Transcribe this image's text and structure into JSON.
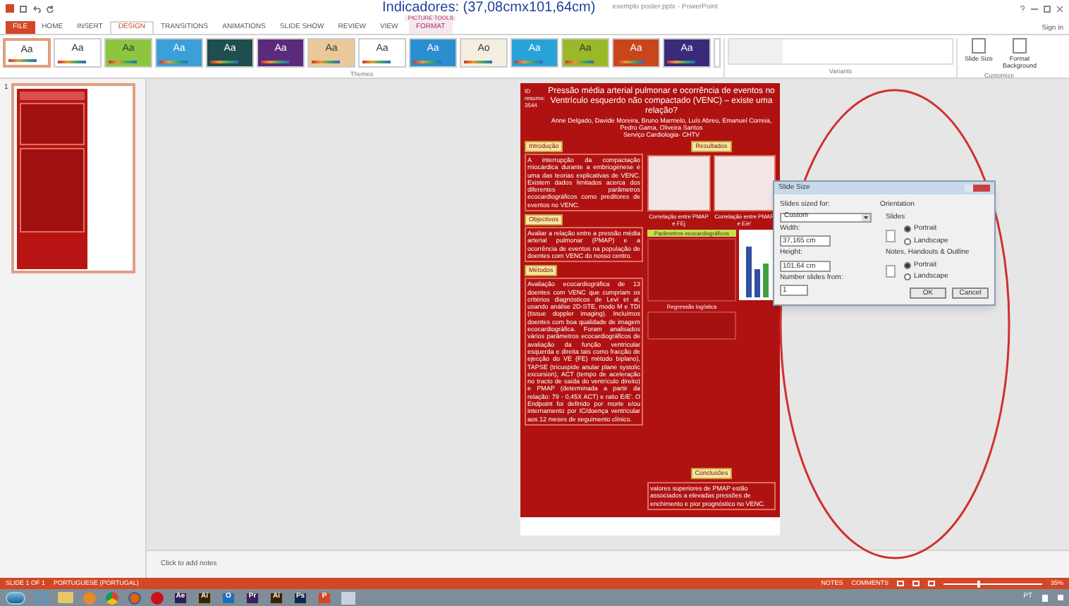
{
  "caption": "Indicadores: (37,08cmx101,64cm)",
  "window": {
    "title": "exemplo poster.pptx - PowerPoint",
    "sign_in": "Sign in"
  },
  "context_tab_group": "PICTURE TOOLS",
  "tabs": [
    {
      "label": "FILE",
      "kind": "file",
      "selected": false
    },
    {
      "label": "HOME",
      "kind": "tab",
      "selected": false
    },
    {
      "label": "INSERT",
      "kind": "tab",
      "selected": false
    },
    {
      "label": "DESIGN",
      "kind": "tab",
      "selected": true
    },
    {
      "label": "TRANSITIONS",
      "kind": "tab",
      "selected": false
    },
    {
      "label": "ANIMATIONS",
      "kind": "tab",
      "selected": false
    },
    {
      "label": "SLIDE SHOW",
      "kind": "tab",
      "selected": false
    },
    {
      "label": "REVIEW",
      "kind": "tab",
      "selected": false
    },
    {
      "label": "VIEW",
      "kind": "tab",
      "selected": false
    },
    {
      "label": "FORMAT",
      "kind": "context",
      "selected": false
    }
  ],
  "themes": {
    "label": "Themes",
    "items": [
      {
        "label": "Aa",
        "color": "#ffffff",
        "selected": true
      },
      {
        "label": "Aa",
        "color": "#ffffff",
        "selected": false
      },
      {
        "label": "Aa",
        "color": "#8cc63f",
        "selected": false
      },
      {
        "label": "Aa",
        "color": "#3b9fd8",
        "selected": false
      },
      {
        "label": "Aa",
        "color": "#1f4e4e",
        "selected": false
      },
      {
        "label": "Aa",
        "color": "#5b2a7a",
        "selected": false
      },
      {
        "label": "Aa",
        "color": "#e9c99a",
        "selected": false
      },
      {
        "label": "Aa",
        "color": "#ffffff",
        "selected": false
      },
      {
        "label": "Aa",
        "color": "#2a8fd0",
        "selected": false
      },
      {
        "label": "Ao",
        "color": "#f3efe0",
        "selected": false
      },
      {
        "label": "Aa",
        "color": "#27a3d8",
        "selected": false
      },
      {
        "label": "Aa",
        "color": "#9bb828",
        "selected": false
      },
      {
        "label": "Aa",
        "color": "#c9461a",
        "selected": false
      },
      {
        "label": "Aa",
        "color": "#3a2a7a",
        "selected": false
      }
    ]
  },
  "variants": {
    "label": "Variants"
  },
  "customize": {
    "label": "Customize",
    "buttons": [
      "Slide Size",
      "Format Background"
    ]
  },
  "thumbnail": {
    "number": "1",
    "selected": true
  },
  "poster": {
    "id": "ID resumo: 3544",
    "title": "Pressão média arterial pulmonar e ocorrência de eventos no Ventrículo esquerdo não compactado (VENC) – existe uma relação?",
    "authors": "Anne Delgado, Davide Moreira, Bruno Marmelo, Luís Abreu, Emanuel Correia, Pedro Gama, Oliveira Santos",
    "service": "Serviço Cardiologia- CHTV",
    "sections": [
      {
        "heading": "Introdução",
        "text": "A interrupção da compactação miocárdica durante a embriogénese é uma das teorias explicativas de VENC. Existem dados limitados acerca dos diferentes parâmetros ecocardiográficos como preditores de eventos no VENC."
      },
      {
        "heading": "Objectivos",
        "text": "Avaliar a relação entre a pressão média arterial pulmonar (PMAP) e a ocorrência de eventos na população de doentes com VENC do nosso centro."
      },
      {
        "heading": "Métodos",
        "text": "Avaliação ecocardiográfica de 13 doentes com VENC que cumpriam os critérios diagnósticos de Levi et al, usando análise 2D-STE, modo M e TDI (tissue doppler imaging). Incluímos doentes com boa qualidade de imagem ecocardiográfica. Foram analisados vários parâmetros ecocardiográficos de avaliação da função ventricular esquerda e direita tais como fracção de ejecção do VE (FE) método biplano), TAPSE (tricuspide anular plane systolic excursion), ACT (tempo de aceleração no tracto de saída do ventrículo direito) e PMAP (determinada a partir da relação: 79 - 0,45X ACT) e ratio E/E'. O Endpoint foi definido por morte e/ou internamento por IC/doença ventricular aos 12 meses de seguimento clínico."
      }
    ],
    "results": {
      "heading": "Resultados",
      "captions": [
        "Correlação entre PMAP e FEj",
        "Correlação entre PMAP e E/e'"
      ],
      "table_title": "Parâmetros ecocardiográficos",
      "regression": "Regressão logística"
    },
    "conclusion": {
      "heading": "Conclusões",
      "text": "valores superiores de PMAP estão associados a elevadas pressões de enchimento e pior prognóstico no VENC."
    }
  },
  "notes": {
    "placeholder": "Click to add notes"
  },
  "dialog": {
    "title": "Slide Size",
    "sized_for_label": "Slides sized for:",
    "sized_for": "Custom",
    "width_label": "Width:",
    "width": "37,165 cm",
    "height_label": "Height:",
    "height": "101,64 cm",
    "number_label": "Number slides from:",
    "number": "1",
    "orientation": "Orientation",
    "groups": [
      {
        "label": "Slides",
        "options": [
          {
            "label": "Portrait",
            "selected": true
          },
          {
            "label": "Landscape",
            "selected": false
          }
        ]
      },
      {
        "label": "Notes, Handouts & Outline",
        "options": [
          {
            "label": "Portrait",
            "selected": true
          },
          {
            "label": "Landscape",
            "selected": false
          }
        ]
      }
    ],
    "buttons": [
      "OK",
      "Cancel"
    ]
  },
  "status_bar": {
    "slide": "SLIDE 1 OF 1",
    "language": "PORTUGUESE (PORTUGAL)",
    "notes": "NOTES",
    "comments": "COMMENTS",
    "zoom": "35%",
    "level": 0.35
  },
  "taskbar": {
    "apps": [
      {
        "kind": "start"
      },
      {
        "kind": "browser"
      },
      {
        "kind": "folder"
      },
      {
        "kind": "media"
      },
      {
        "kind": "chrome"
      },
      {
        "kind": "firefox"
      },
      {
        "kind": "opera"
      },
      {
        "kind": "letter",
        "label": "Ae",
        "color": "#2a1f5c"
      },
      {
        "kind": "letter",
        "label": "Ai",
        "color": "#3a2400"
      },
      {
        "kind": "letter",
        "label": "O",
        "color": "#1e6fc2"
      },
      {
        "kind": "letter",
        "label": "Pr",
        "color": "#3a1f5c"
      },
      {
        "kind": "letter",
        "label": "Ai",
        "color": "#3a2400"
      },
      {
        "kind": "letter",
        "label": "Ps",
        "color": "#0f2a4a"
      },
      {
        "kind": "letter",
        "label": "P",
        "color": "#d24726"
      },
      {
        "kind": "blank"
      }
    ],
    "language": "PT"
  }
}
